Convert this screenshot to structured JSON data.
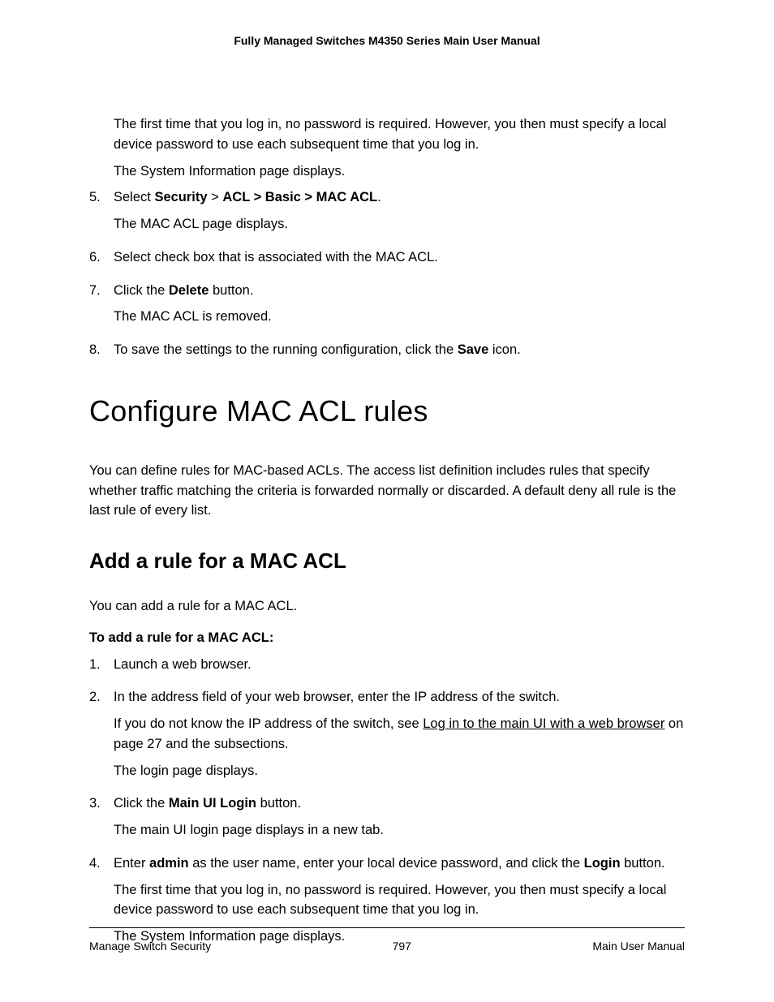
{
  "header": {
    "title": "Fully Managed Switches M4350 Series Main User Manual"
  },
  "top": {
    "para1": "The first time that you log in, no password is required. However, you then must specify a local device password to use each subsequent time that you log in.",
    "para2": "The System Information page displays.",
    "step5_num": "5.",
    "step5_a": "Select ",
    "step5_b": "Security",
    "step5_c": " > ",
    "step5_d": "ACL > Basic > MAC ACL",
    "step5_e": ".",
    "step5_sub": "The MAC ACL page displays.",
    "step6_num": "6.",
    "step6": "Select check box that is associated with the MAC ACL.",
    "step7_num": "7.",
    "step7_a": "Click the ",
    "step7_b": "Delete",
    "step7_c": " button.",
    "step7_sub": "The MAC ACL is removed.",
    "step8_num": "8.",
    "step8_a": "To save the settings to the running configuration, click the ",
    "step8_b": "Save",
    "step8_c": " icon."
  },
  "section": {
    "h1": "Configure MAC ACL rules",
    "intro": "You can define rules for MAC-based ACLs. The access list definition includes rules that specify whether traffic matching the criteria is forwarded normally or discarded. A default deny all rule is the last rule of every list.",
    "h2": "Add a rule for a MAC ACL",
    "sub_intro": "You can add a rule for a MAC ACL.",
    "procedure_title": "To add a rule for a MAC ACL:",
    "s1_num": "1.",
    "s1": "Launch a web browser.",
    "s2_num": "2.",
    "s2": "In the address field of your web browser, enter the IP address of the switch.",
    "s2_sub_a": "If you do not know the IP address of the switch, see ",
    "s2_sub_link": "Log in to the main UI with a web browser",
    "s2_sub_b": " on page 27 and the subsections.",
    "s2_sub2": "The login page displays.",
    "s3_num": "3.",
    "s3_a": "Click the ",
    "s3_b": "Main UI Login",
    "s3_c": " button.",
    "s3_sub": "The main UI login page displays in a new tab.",
    "s4_num": "4.",
    "s4_a": "Enter ",
    "s4_b": "admin",
    "s4_c": " as the user name, enter your local device password, and click the ",
    "s4_d": "Login",
    "s4_e": " button.",
    "s4_sub1": "The first time that you log in, no password is required. However, you then must specify a local device password to use each subsequent time that you log in.",
    "s4_sub2": "The System Information page displays."
  },
  "footer": {
    "left": "Manage Switch Security",
    "center": "797",
    "right": "Main User Manual"
  }
}
